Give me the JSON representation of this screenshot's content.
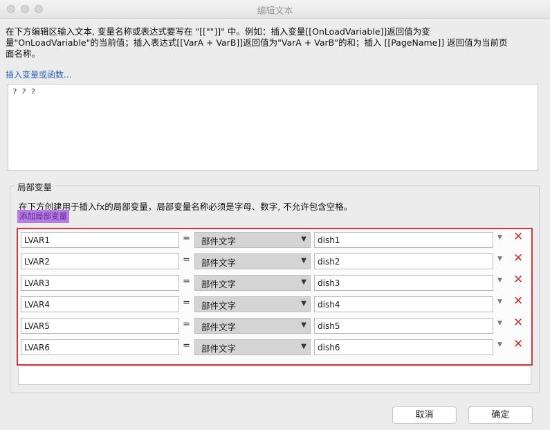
{
  "window": {
    "title": "编辑文本"
  },
  "instructions": {
    "line1": "在下方编辑区输入文本, 变量名称或表达式要写在 \"[[\"\"]]\" 中。例如：插入变量[[OnLoadVariable]]返回值为变",
    "line2": "量\"OnLoadVariable\"的当前值；插入表达式[[VarA + VarB]]返回值为\"VarA + VarB\"的和；插入 [[PageName]] 返回值为当前页",
    "line3": "面名称。"
  },
  "insert_link": "插入变量或函数...",
  "editor": {
    "value": "? ? ?"
  },
  "local_vars": {
    "group_label": "局部变量",
    "description": "在下方创建用于插入fx的局部变量，局部变量名称必须是字母、数字, 不允许包含空格。",
    "add_label": "添加局部变量",
    "equals": "=",
    "rows": [
      {
        "name": "LVAR1",
        "type": "部件文字",
        "target": "dish1"
      },
      {
        "name": "LVAR2",
        "type": "部件文字",
        "target": "dish2"
      },
      {
        "name": "LVAR3",
        "type": "部件文字",
        "target": "dish3"
      },
      {
        "name": "LVAR4",
        "type": "部件文字",
        "target": "dish4"
      },
      {
        "name": "LVAR5",
        "type": "部件文字",
        "target": "dish5"
      },
      {
        "name": "LVAR6",
        "type": "部件文字",
        "target": "dish6"
      }
    ]
  },
  "footer": {
    "cancel": "取消",
    "ok": "确定"
  }
}
